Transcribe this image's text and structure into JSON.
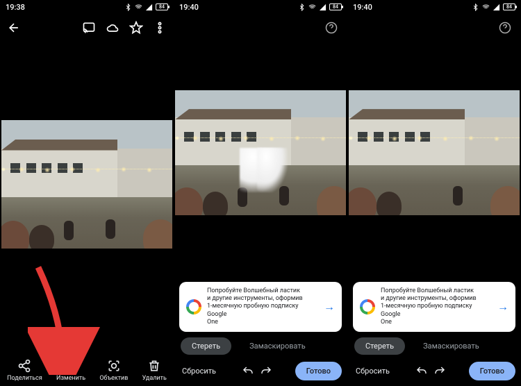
{
  "status": {
    "time_left": "19:38",
    "time_right": "19:40",
    "battery": "84"
  },
  "pane1": {
    "nav": {
      "share": "Поделиться",
      "edit": "Изменить",
      "lens": "Объектив",
      "delete": "Удалить"
    }
  },
  "promo": {
    "line1": "Попробуйте Волшебный ластик",
    "line2": "и другие инструменты, оформив",
    "line3": "1-месячную пробную подписку Google",
    "line4": "One"
  },
  "tools": {
    "erase": "Стереть",
    "mask": "Замаскировать"
  },
  "editor": {
    "reset": "Сбросить",
    "done": "Готово"
  }
}
